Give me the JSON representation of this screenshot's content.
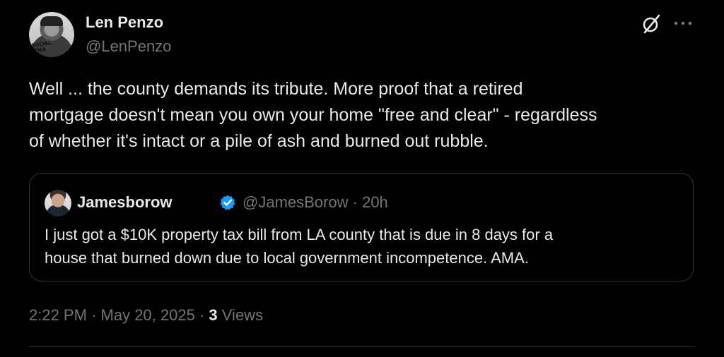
{
  "author": {
    "display_name": "Len Penzo",
    "handle": "@LenPenzo",
    "avatar_icon": "avatar",
    "avatar_stamp_text": "SOCIAL ITMA"
  },
  "actions": {
    "grok_icon": "grok-icon",
    "more_icon": "more-icon"
  },
  "tweet": {
    "text": "Well ... the county demands its tribute. More proof that a retired\nmortgage doesn't mean you own your home \"free and clear\" - regardless\nof whether it's intact or a pile of ash and burned out rubble."
  },
  "quote": {
    "display_name": "Jamesborow",
    "verified_icon": "verified-badge-icon",
    "handle": "@JamesBorow",
    "separator": "·",
    "time": "20h",
    "text": "I just got a $10K property tax bill from LA county that is due in 8 days for a\nhouse that burned down due to local government incompetence. AMA."
  },
  "meta": {
    "time": "2:22 PM",
    "separator": "·",
    "date": "May 20, 2025",
    "views_count": "3",
    "views_label": "Views"
  },
  "colors": {
    "background": "#000000",
    "text_primary": "#e7e9ea",
    "text_secondary": "#71767b",
    "border": "#2f3336",
    "verified_blue": "#1d9bf0"
  }
}
